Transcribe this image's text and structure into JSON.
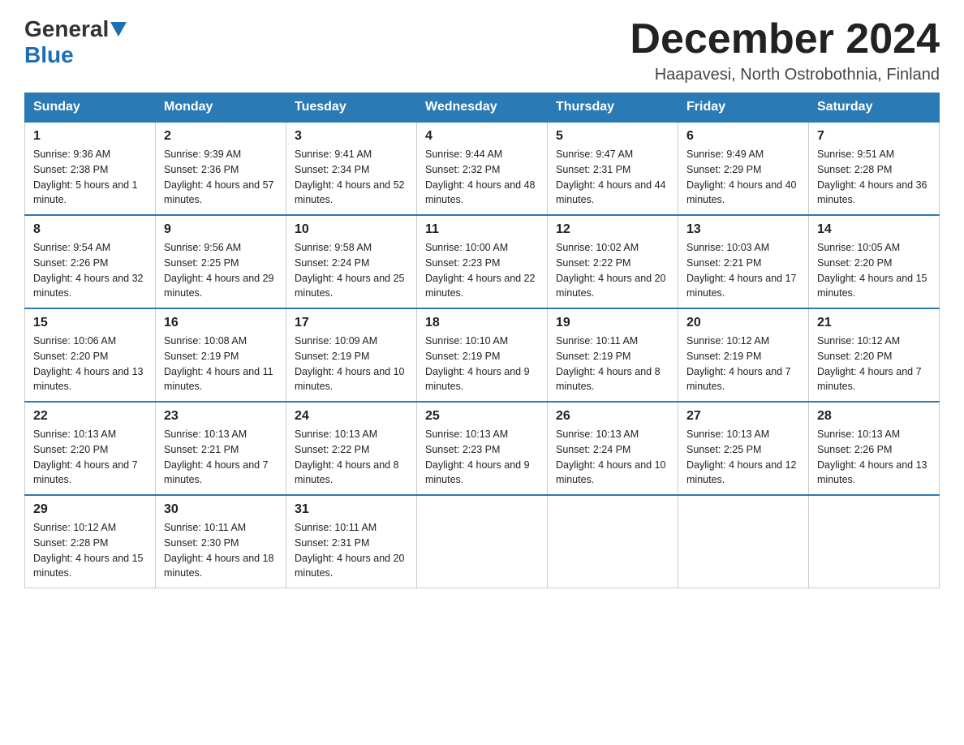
{
  "header": {
    "logo_general": "General",
    "logo_blue": "Blue",
    "month_title": "December 2024",
    "location": "Haapavesi, North Ostrobothnia, Finland"
  },
  "days_of_week": [
    "Sunday",
    "Monday",
    "Tuesday",
    "Wednesday",
    "Thursday",
    "Friday",
    "Saturday"
  ],
  "weeks": [
    [
      {
        "day": "1",
        "sunrise": "9:36 AM",
        "sunset": "2:38 PM",
        "daylight": "5 hours and 1 minute."
      },
      {
        "day": "2",
        "sunrise": "9:39 AM",
        "sunset": "2:36 PM",
        "daylight": "4 hours and 57 minutes."
      },
      {
        "day": "3",
        "sunrise": "9:41 AM",
        "sunset": "2:34 PM",
        "daylight": "4 hours and 52 minutes."
      },
      {
        "day": "4",
        "sunrise": "9:44 AM",
        "sunset": "2:32 PM",
        "daylight": "4 hours and 48 minutes."
      },
      {
        "day": "5",
        "sunrise": "9:47 AM",
        "sunset": "2:31 PM",
        "daylight": "4 hours and 44 minutes."
      },
      {
        "day": "6",
        "sunrise": "9:49 AM",
        "sunset": "2:29 PM",
        "daylight": "4 hours and 40 minutes."
      },
      {
        "day": "7",
        "sunrise": "9:51 AM",
        "sunset": "2:28 PM",
        "daylight": "4 hours and 36 minutes."
      }
    ],
    [
      {
        "day": "8",
        "sunrise": "9:54 AM",
        "sunset": "2:26 PM",
        "daylight": "4 hours and 32 minutes."
      },
      {
        "day": "9",
        "sunrise": "9:56 AM",
        "sunset": "2:25 PM",
        "daylight": "4 hours and 29 minutes."
      },
      {
        "day": "10",
        "sunrise": "9:58 AM",
        "sunset": "2:24 PM",
        "daylight": "4 hours and 25 minutes."
      },
      {
        "day": "11",
        "sunrise": "10:00 AM",
        "sunset": "2:23 PM",
        "daylight": "4 hours and 22 minutes."
      },
      {
        "day": "12",
        "sunrise": "10:02 AM",
        "sunset": "2:22 PM",
        "daylight": "4 hours and 20 minutes."
      },
      {
        "day": "13",
        "sunrise": "10:03 AM",
        "sunset": "2:21 PM",
        "daylight": "4 hours and 17 minutes."
      },
      {
        "day": "14",
        "sunrise": "10:05 AM",
        "sunset": "2:20 PM",
        "daylight": "4 hours and 15 minutes."
      }
    ],
    [
      {
        "day": "15",
        "sunrise": "10:06 AM",
        "sunset": "2:20 PM",
        "daylight": "4 hours and 13 minutes."
      },
      {
        "day": "16",
        "sunrise": "10:08 AM",
        "sunset": "2:19 PM",
        "daylight": "4 hours and 11 minutes."
      },
      {
        "day": "17",
        "sunrise": "10:09 AM",
        "sunset": "2:19 PM",
        "daylight": "4 hours and 10 minutes."
      },
      {
        "day": "18",
        "sunrise": "10:10 AM",
        "sunset": "2:19 PM",
        "daylight": "4 hours and 9 minutes."
      },
      {
        "day": "19",
        "sunrise": "10:11 AM",
        "sunset": "2:19 PM",
        "daylight": "4 hours and 8 minutes."
      },
      {
        "day": "20",
        "sunrise": "10:12 AM",
        "sunset": "2:19 PM",
        "daylight": "4 hours and 7 minutes."
      },
      {
        "day": "21",
        "sunrise": "10:12 AM",
        "sunset": "2:20 PM",
        "daylight": "4 hours and 7 minutes."
      }
    ],
    [
      {
        "day": "22",
        "sunrise": "10:13 AM",
        "sunset": "2:20 PM",
        "daylight": "4 hours and 7 minutes."
      },
      {
        "day": "23",
        "sunrise": "10:13 AM",
        "sunset": "2:21 PM",
        "daylight": "4 hours and 7 minutes."
      },
      {
        "day": "24",
        "sunrise": "10:13 AM",
        "sunset": "2:22 PM",
        "daylight": "4 hours and 8 minutes."
      },
      {
        "day": "25",
        "sunrise": "10:13 AM",
        "sunset": "2:23 PM",
        "daylight": "4 hours and 9 minutes."
      },
      {
        "day": "26",
        "sunrise": "10:13 AM",
        "sunset": "2:24 PM",
        "daylight": "4 hours and 10 minutes."
      },
      {
        "day": "27",
        "sunrise": "10:13 AM",
        "sunset": "2:25 PM",
        "daylight": "4 hours and 12 minutes."
      },
      {
        "day": "28",
        "sunrise": "10:13 AM",
        "sunset": "2:26 PM",
        "daylight": "4 hours and 13 minutes."
      }
    ],
    [
      {
        "day": "29",
        "sunrise": "10:12 AM",
        "sunset": "2:28 PM",
        "daylight": "4 hours and 15 minutes."
      },
      {
        "day": "30",
        "sunrise": "10:11 AM",
        "sunset": "2:30 PM",
        "daylight": "4 hours and 18 minutes."
      },
      {
        "day": "31",
        "sunrise": "10:11 AM",
        "sunset": "2:31 PM",
        "daylight": "4 hours and 20 minutes."
      },
      null,
      null,
      null,
      null
    ]
  ]
}
